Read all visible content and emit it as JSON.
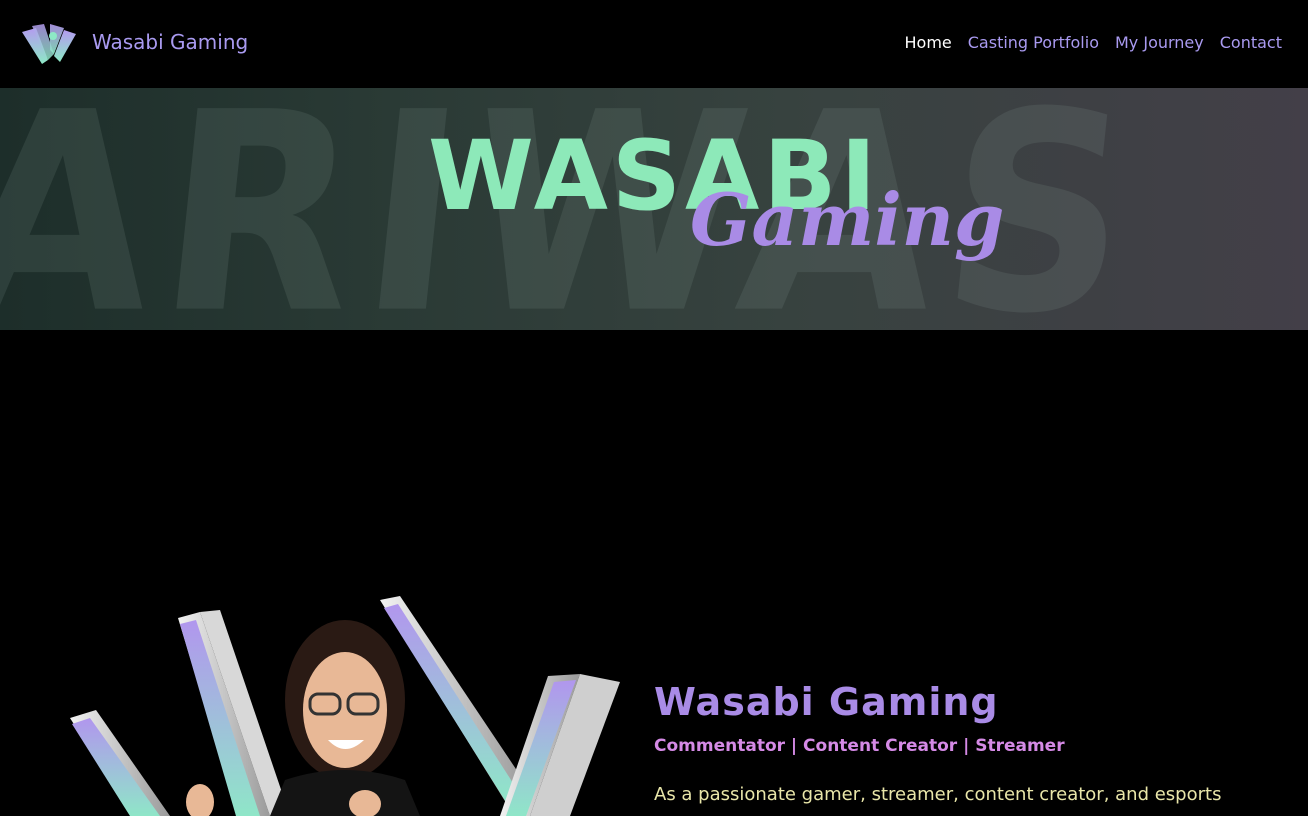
{
  "nav": {
    "brand": "Wasabi Gaming",
    "links": [
      {
        "label": "Home",
        "active": true
      },
      {
        "label": "Casting Portfolio",
        "active": false
      },
      {
        "label": "My Journey",
        "active": false
      },
      {
        "label": "Contact",
        "active": false
      }
    ]
  },
  "hero": {
    "title": "WASABI",
    "subtitle": "Gaming"
  },
  "profile": {
    "name": "Wasabi Gaming",
    "roles": "Commentator | Content Creator | Streamer",
    "bio": "As a passionate gamer, streamer, content creator, and esports"
  },
  "colors": {
    "accent_purple": "#a99af0",
    "mint": "#8de9b9",
    "pink": "#d58ae6",
    "bio_text": "#e9e6a9"
  }
}
